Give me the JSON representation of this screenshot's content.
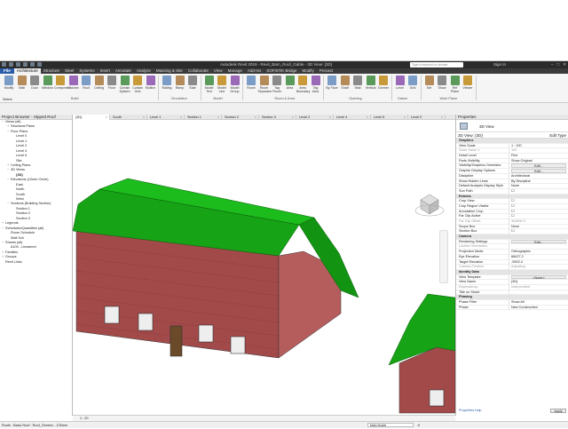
{
  "app": {
    "title": "Autodesk Revit 2019 - Revit_Barn_Roof_Gable - 3D View: {3D}",
    "search_placeholder": "Type a keyword or phrase",
    "sign_in": "Sign In"
  },
  "tabs": [
    "File",
    "Architecture",
    "Structure",
    "Steel",
    "Systems",
    "Insert",
    "Annotate",
    "Analyze",
    "Massing & Site",
    "Collaborate",
    "View",
    "Manage",
    "Add-Ins",
    "SOFiSTiK Bridge",
    "Modify",
    "Precast"
  ],
  "ribbon": {
    "select_label": "Select",
    "build": {
      "panel": "Build",
      "buttons": [
        "Modify",
        "Wall",
        "Door",
        "Window",
        "Component",
        "Column",
        "Roof",
        "Ceiling",
        "Floor",
        "Curtain System",
        "Curtain Grid",
        "Mullion"
      ]
    },
    "circulation": {
      "panel": "Circulation",
      "buttons": [
        "Railing",
        "Ramp",
        "Stair"
      ]
    },
    "model": {
      "panel": "Model",
      "buttons": [
        "Model Text",
        "Model Line",
        "Model Group"
      ]
    },
    "room_area": {
      "panel": "Room & Area",
      "buttons": [
        "Room",
        "Room Separator",
        "Tag Room",
        "Area",
        "Area Boundary",
        "Tag Area"
      ]
    },
    "opening": {
      "panel": "Opening",
      "buttons": [
        "By Face",
        "Shaft",
        "Wall",
        "Vertical",
        "Dormer"
      ]
    },
    "datum": {
      "panel": "Datum",
      "buttons": [
        "Level",
        "Grid"
      ]
    },
    "work_plane": {
      "panel": "Work Plane",
      "buttons": [
        "Set",
        "Show",
        "Ref Plane",
        "Viewer"
      ]
    }
  },
  "project_browser": {
    "title": "Project Browser - Hipped Roof",
    "tree": [
      {
        "label": "Views (all)",
        "depth": 0,
        "glyph": "−"
      },
      {
        "label": "Structural Plans",
        "depth": 1,
        "glyph": "+"
      },
      {
        "label": "Floor Plans",
        "depth": 1,
        "glyph": "−"
      },
      {
        "label": "Level 0",
        "depth": 2,
        "glyph": ""
      },
      {
        "label": "Level 1",
        "depth": 2,
        "glyph": ""
      },
      {
        "label": "Level 2",
        "depth": 2,
        "glyph": ""
      },
      {
        "label": "Level 4",
        "depth": 2,
        "glyph": ""
      },
      {
        "label": "Level 5",
        "depth": 2,
        "glyph": ""
      },
      {
        "label": "Site",
        "depth": 2,
        "glyph": ""
      },
      {
        "label": "Ceiling Plans",
        "depth": 1,
        "glyph": "+"
      },
      {
        "label": "3D Views",
        "depth": 1,
        "glyph": "−"
      },
      {
        "label": "{3D}",
        "depth": 2,
        "glyph": "",
        "bold": true
      },
      {
        "label": "Elevations (12mm Circle)",
        "depth": 1,
        "glyph": "−"
      },
      {
        "label": "East",
        "depth": 2,
        "glyph": ""
      },
      {
        "label": "North",
        "depth": 2,
        "glyph": ""
      },
      {
        "label": "South",
        "depth": 2,
        "glyph": ""
      },
      {
        "label": "West",
        "depth": 2,
        "glyph": ""
      },
      {
        "label": "Sections (Building Section)",
        "depth": 1,
        "glyph": "−"
      },
      {
        "label": "Section 1",
        "depth": 2,
        "glyph": ""
      },
      {
        "label": "Section 2",
        "depth": 2,
        "glyph": ""
      },
      {
        "label": "Section 3",
        "depth": 2,
        "glyph": ""
      },
      {
        "label": "Legends",
        "depth": 0,
        "glyph": "+"
      },
      {
        "label": "Schedules/Quantities (all)",
        "depth": 0,
        "glyph": "−"
      },
      {
        "label": "Room Schedule",
        "depth": 1,
        "glyph": ""
      },
      {
        "label": "Wall Sch",
        "depth": 1,
        "glyph": ""
      },
      {
        "label": "Sheets (all)",
        "depth": 0,
        "glyph": "−"
      },
      {
        "label": "A100 - Unnamed",
        "depth": 1,
        "glyph": ""
      },
      {
        "label": "Families",
        "depth": 0,
        "glyph": "+"
      },
      {
        "label": "Groups",
        "depth": 0,
        "glyph": "+"
      },
      {
        "label": "Revit Links",
        "depth": 0,
        "glyph": ""
      }
    ]
  },
  "view_tabs": [
    "{3D}",
    "South",
    "Level 1",
    "Section 1",
    "Section 2",
    "Section 3",
    "Level 2",
    "Level 4",
    "Level 5",
    "Level 0"
  ],
  "view_control": {
    "scale": "1 : 20"
  },
  "properties": {
    "title": "Properties",
    "type_name": "3D View",
    "filter": "3D View: {3D}",
    "edit_type": "Edit Type",
    "rows": [
      {
        "k": "Graphics",
        "v": "",
        "sec": true
      },
      {
        "k": "View Scale",
        "v": "1 : 100"
      },
      {
        "k": "Scale Value    1:",
        "v": "100",
        "dim": true
      },
      {
        "k": "Detail Level",
        "v": "Fine"
      },
      {
        "k": "Parts Visibility",
        "v": "Show Original"
      },
      {
        "k": "Visibility/Graphics Overrides",
        "v": "Edit...",
        "btn": true
      },
      {
        "k": "Graphic Display Options",
        "v": "Edit...",
        "btn": true
      },
      {
        "k": "Discipline",
        "v": "Architectural"
      },
      {
        "k": "Show Hidden Lines",
        "v": "By Discipline"
      },
      {
        "k": "Default Analysis Display Style",
        "v": "None"
      },
      {
        "k": "Sun Path",
        "v": "☐"
      },
      {
        "k": "Extents",
        "v": "",
        "sec": true
      },
      {
        "k": "Crop View",
        "v": "☐"
      },
      {
        "k": "Crop Region Visible",
        "v": "☐"
      },
      {
        "k": "Annotation Crop",
        "v": "☐"
      },
      {
        "k": "Far Clip Active",
        "v": "☐"
      },
      {
        "k": "Far Clip Offset",
        "v": "304800.0",
        "dim": true
      },
      {
        "k": "Scope Box",
        "v": "None"
      },
      {
        "k": "Section Box",
        "v": "☐"
      },
      {
        "k": "Camera",
        "v": "",
        "sec": true
      },
      {
        "k": "Rendering Settings",
        "v": "Edit...",
        "btn": true
      },
      {
        "k": "Locked Orientation",
        "v": "",
        "dim": true
      },
      {
        "k": "Projection Mode",
        "v": "Orthographic"
      },
      {
        "k": "Eye Elevation",
        "v": "68427.2"
      },
      {
        "k": "Target Elevation",
        "v": "-9902.4"
      },
      {
        "k": "Camera Position",
        "v": "Adjusting",
        "dim": true
      },
      {
        "k": "Identity Data",
        "v": "",
        "sec": true
      },
      {
        "k": "View Template",
        "v": "<None>",
        "btn": true
      },
      {
        "k": "View Name",
        "v": "{3D}"
      },
      {
        "k": "Dependency",
        "v": "Independent",
        "dim": true
      },
      {
        "k": "Title on Sheet",
        "v": ""
      },
      {
        "k": "Phasing",
        "v": "",
        "sec": true
      },
      {
        "k": "Phase Filter",
        "v": "Show All"
      },
      {
        "k": "Phase",
        "v": "New Construction"
      }
    ],
    "help": "Properties help",
    "apply": "Apply"
  },
  "status": {
    "text": "Roofs : Basic Roof : Roof_Generic - 125mm",
    "workset": "Main Model",
    "selection_count": ":0"
  },
  "colors": {
    "roof": "#15a815",
    "brick": "#a04848",
    "ribbon_accent": "#2a5caa"
  }
}
